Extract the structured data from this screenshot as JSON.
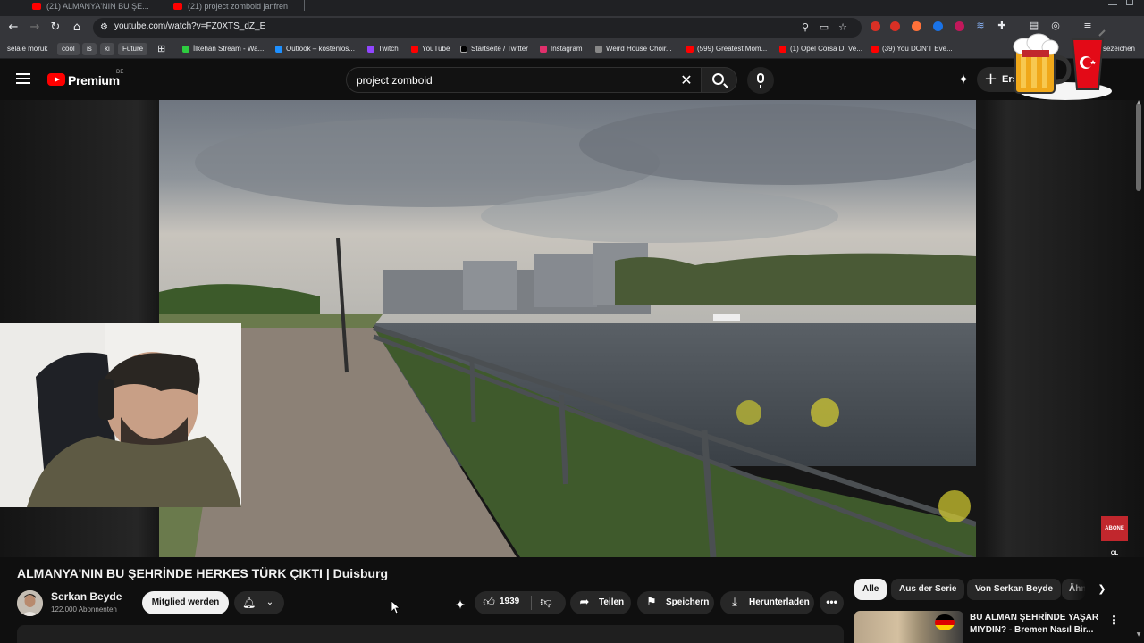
{
  "browser": {
    "tabs": [
      {
        "title": "(21) ALMANYA'NIN BU ŞE..."
      },
      {
        "title": "(21) project zomboid janfren"
      }
    ],
    "address_url": "youtube.com/watch?v=FZ0XTS_dZ_E",
    "bookmarks": [
      {
        "label": "selale moruk",
        "color": "#00000000"
      },
      {
        "label": "cool",
        "color": "#00000000"
      },
      {
        "label": "is",
        "color": "#00000000"
      },
      {
        "label": "ki",
        "color": "#00000000"
      },
      {
        "label": "Future",
        "color": "#00000000"
      },
      {
        "label": "İlkehan Stream - Wa...",
        "color": "#2ecc40"
      },
      {
        "label": "Outlook – kostenlos...",
        "color": "#1e90ff"
      },
      {
        "label": "Twitch",
        "color": "#9146ff"
      },
      {
        "label": "YouTube",
        "color": "#ff0000"
      },
      {
        "label": "Startseite / Twitter",
        "color": "#000000"
      },
      {
        "label": "Instagram",
        "color": "#e1306c"
      },
      {
        "label": "Weird House Choir...",
        "color": "#888888"
      },
      {
        "label": "(599) Greatest Mom...",
        "color": "#ff0000"
      },
      {
        "label": "(1) Opel Corsa D: Ve...",
        "color": "#ff0000"
      },
      {
        "label": "(39) You DON'T Eve...",
        "color": "#ff0000"
      }
    ],
    "bookmarks_overflow": "esezeichen"
  },
  "youtube": {
    "brand": "Premium",
    "region": "DE",
    "search_query": "project zomboid",
    "create_label": "Erst"
  },
  "video": {
    "title": "ALMANYA'NIN BU ŞEHRİNDE HERKES TÜRK ÇIKTI | Duisburg",
    "channel_name": "Serkan Beyde",
    "subscribers": "122.000 Abonnenten",
    "join_label": "Mitglied werden",
    "like_count": "1939",
    "share_label": "Teilen",
    "save_label": "Speichern",
    "download_label": "Herunterladen",
    "abone_badge": "ABONE OL"
  },
  "sidebar": {
    "chips": [
      {
        "label": "Alle",
        "active": true
      },
      {
        "label": "Aus der Serie",
        "active": false
      },
      {
        "label": "Von Serkan Beyde",
        "active": false
      },
      {
        "label": "Ähn",
        "active": false
      }
    ],
    "related": [
      {
        "title": "BU ALMAN ŞEHRİNDE YAŞAR MIYDIN? - Bremen Nasıl Bir..."
      }
    ]
  },
  "colors": {
    "accent_red": "#ff0000",
    "background": "#0f0f0f",
    "button_bg": "#272727"
  }
}
